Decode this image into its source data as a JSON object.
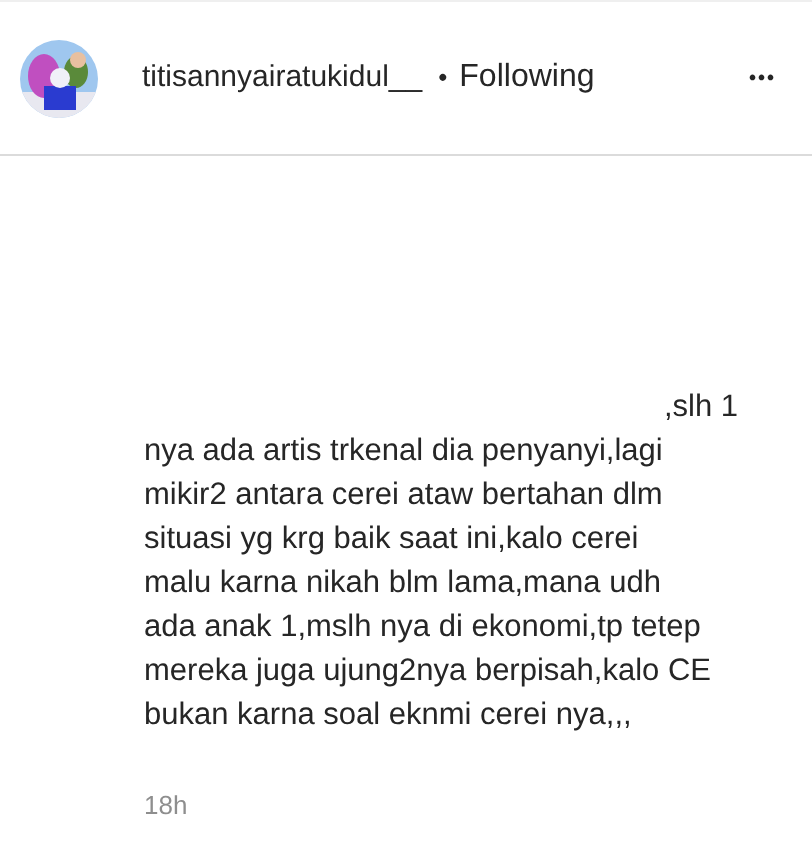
{
  "header": {
    "username": "titisannyairatukidul__",
    "separator": "•",
    "follow_status": "Following",
    "more": "•••"
  },
  "comment": {
    "lines": [
      ",slh 1",
      "nya ada artis trkenal dia penyanyi,lagi",
      "mikir2 antara cerei ataw bertahan dlm",
      "situasi yg krg baik saat ini,kalo cerei",
      "malu karna nikah blm lama,mana udh",
      "ada anak 1,mslh nya di ekonomi,tp tetep",
      "mereka juga ujung2nya berpisah,kalo CE",
      "bukan karna soal eknmi cerei nya,,,"
    ],
    "time": "18h"
  }
}
